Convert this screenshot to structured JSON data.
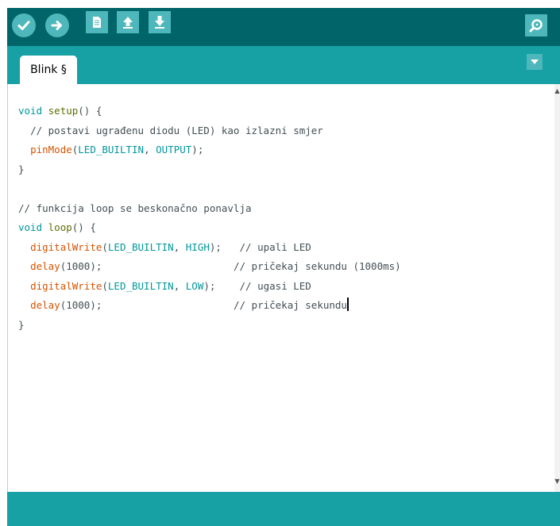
{
  "toolbar": {
    "buttons": [
      {
        "name": "verify-button",
        "icon": "checkmark-icon"
      },
      {
        "name": "upload-button",
        "icon": "arrow-right-icon"
      },
      {
        "name": "new-button",
        "icon": "document-icon"
      },
      {
        "name": "open-button",
        "icon": "arrow-up-icon"
      },
      {
        "name": "save-button",
        "icon": "arrow-down-icon"
      }
    ],
    "serial_monitor_icon": "magnifier-icon"
  },
  "tabs": [
    {
      "label": "Blink §"
    }
  ],
  "tab_menu_icon": "triangle-down-icon",
  "code": {
    "setup_type": "void",
    "setup_name": "setup",
    "setup_open": "() {",
    "setup_comment": "// postavi ugrađenu diodu (LED) kao izlazni smjer",
    "pinmode_fn": "pinMode",
    "pinmode_open": "(",
    "pinmode_arg1": "LED_BUILTIN",
    "pinmode_sep": ", ",
    "pinmode_arg2": "OUTPUT",
    "pinmode_close": ");",
    "setup_close": "}",
    "loop_comment": "// funkcija loop se beskonačno ponavlja",
    "loop_type": "void",
    "loop_name": "loop",
    "loop_open": "() {",
    "dw1_fn": "digitalWrite",
    "dw1_open": "(",
    "dw1_arg1": "LED_BUILTIN",
    "dw1_sep": ", ",
    "dw1_arg2": "HIGH",
    "dw1_close": ");",
    "dw1_pad": "   ",
    "dw1_comment": "// upali LED",
    "delay1_fn": "delay",
    "delay1_args": "(1000);",
    "delay1_pad": "                      ",
    "delay1_comment": "// pričekaj sekundu (1000ms)",
    "dw2_fn": "digitalWrite",
    "dw2_open": "(",
    "dw2_arg1": "LED_BUILTIN",
    "dw2_sep": ", ",
    "dw2_arg2": "LOW",
    "dw2_close": ");",
    "dw2_pad": "    ",
    "dw2_comment": "// ugasi LED",
    "delay2_fn": "delay",
    "delay2_args": "(1000);",
    "delay2_pad": "                      ",
    "delay2_comment": "// pričekaj sekundu",
    "loop_close": "}"
  },
  "colors": {
    "toolbar_bg": "#006468",
    "tabbar_bg": "#17a1a5",
    "button_bg": "#4db7bb",
    "keyword_type": "#00979c",
    "keyword_function": "#5e6d03",
    "keyword_api": "#d35400",
    "comment": "#434f54"
  }
}
